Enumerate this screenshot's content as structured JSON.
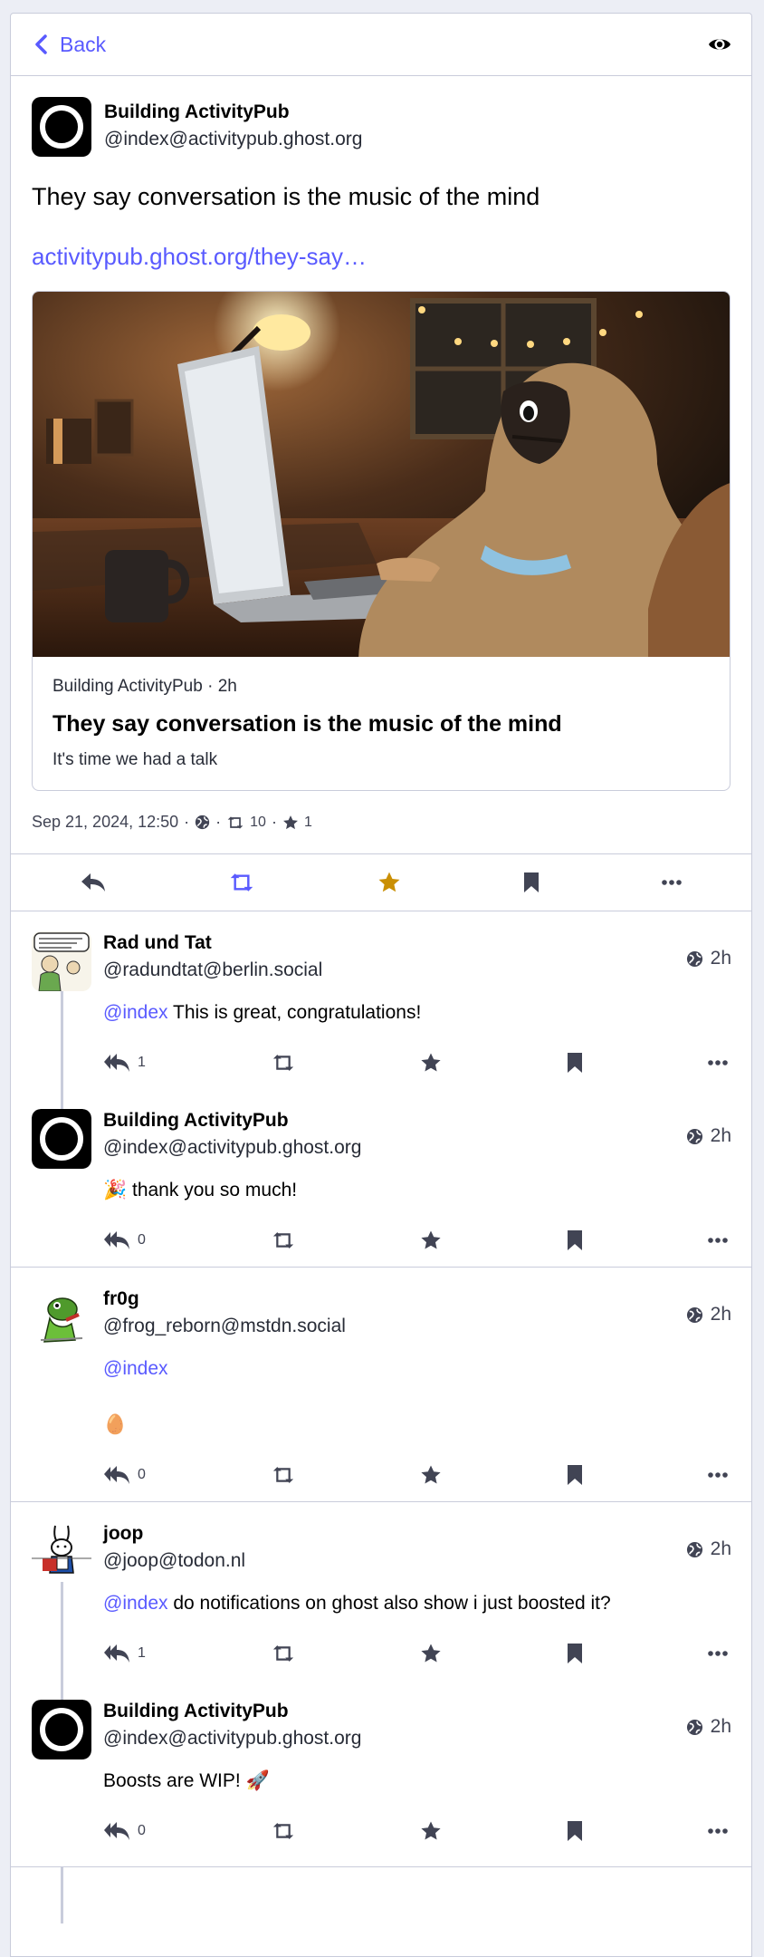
{
  "header": {
    "back_label": "Back"
  },
  "status": {
    "author_name": "Building ActivityPub",
    "author_handle": "@index@activitypub.ghost.org",
    "text": "They say conversation is the music of the mind",
    "link": "activitypub.ghost.org/they-say…",
    "card": {
      "meta": "Building ActivityPub · 2h",
      "title": "They say conversation is the music of the mind",
      "description": "It's time we had a talk"
    },
    "date": "Sep 21, 2024, 12:50",
    "separator": "·",
    "boosts": "10",
    "favourites": "1"
  },
  "replies": [
    {
      "name": "Rad und Tat",
      "handle": "@radundtat@berlin.social",
      "time": "2h",
      "mention": "@index",
      "text": " This is great, congratulations!",
      "reply_count": "1"
    },
    {
      "name": "Building ActivityPub",
      "handle": "@index@activitypub.ghost.org",
      "time": "2h",
      "emoji": "🎉",
      "text": " thank you so much!",
      "reply_count": "0"
    },
    {
      "name": "fr0g",
      "handle": "@frog_reborn@mstdn.social",
      "time": "2h",
      "mention": "@index",
      "emoji": "🥚",
      "reply_count": "0"
    },
    {
      "name": "joop",
      "handle": "@joop@todon.nl",
      "time": "2h",
      "mention": "@index",
      "text": " do notifications on ghost also show i just boosted it?",
      "reply_count": "1"
    },
    {
      "name": "Building ActivityPub",
      "handle": "@index@activitypub.ghost.org",
      "time": "2h",
      "text": "Boosts are WIP! ",
      "emoji": "🚀",
      "reply_count": "0"
    }
  ],
  "colors": {
    "accent": "#595aff",
    "favourited": "#ca8f04",
    "icon": "#414454",
    "border": "#c9ccdb"
  }
}
